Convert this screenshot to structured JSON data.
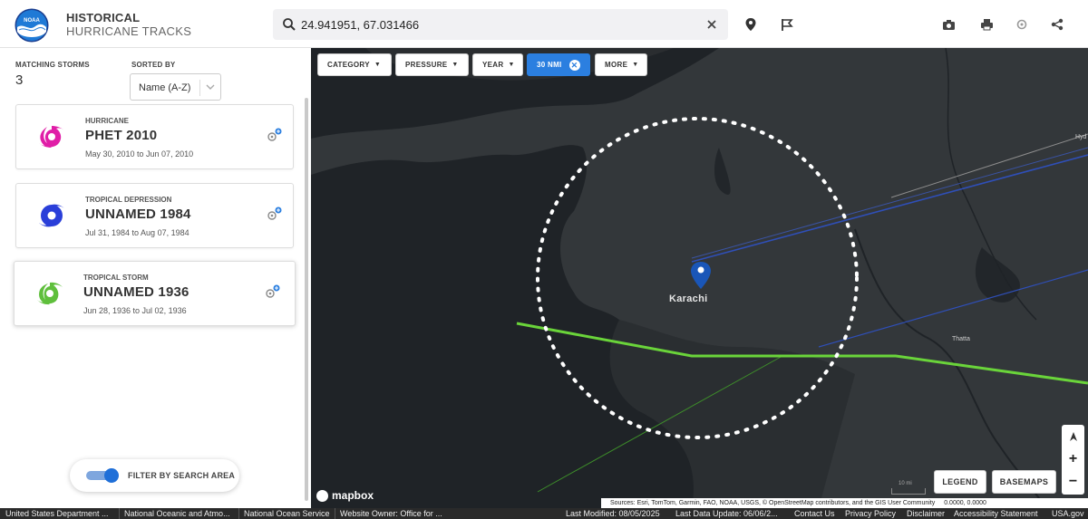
{
  "header": {
    "logo_text": "NOAA",
    "title_line1": "HISTORICAL",
    "title_line2": "HURRICANE TRACKS",
    "search_value": "24.941951, 67.031466"
  },
  "sidebar": {
    "matching_label": "MATCHING STORMS",
    "matching_count": "3",
    "sorted_label": "SORTED BY",
    "sort_value": "Name (A-Z)",
    "filter_toggle_label": "FILTER BY SEARCH AREA",
    "filter_toggle_on": true,
    "storms": [
      {
        "category": "HURRICANE",
        "name": "PHET 2010",
        "dates": "May 30, 2010 to Jun 07, 2010",
        "color": "#e01ea7"
      },
      {
        "category": "TROPICAL DEPRESSION",
        "name": "UNNAMED 1984",
        "dates": "Jul 31, 1984 to Aug 07, 1984",
        "color": "#2a3fd9"
      },
      {
        "category": "TROPICAL STORM",
        "name": "UNNAMED 1936",
        "dates": "Jun 28, 1936 to Jul 02, 1936",
        "color": "#5fbf3c"
      }
    ]
  },
  "map": {
    "filters": {
      "category": "CATEGORY",
      "pressure": "PRESSURE",
      "year": "YEAR",
      "radius": "30 NMI",
      "more": "MORE"
    },
    "city_label": "Karachi",
    "place_thatta": "Thatta",
    "place_hyd": "Hyd",
    "legend_label": "LEGEND",
    "basemaps_label": "BASEMAPS",
    "mapbox_label": "mapbox",
    "scale_label": "10 mi",
    "attribution": "Sources: Esri, TomTom, Garmin, FAO, NOAA, USGS, © OpenStreetMap contributors, and the GIS User Community",
    "coords": "0.0000, 0.0000",
    "zoom_in": "+",
    "zoom_out": "−",
    "colors": {
      "search_circle": "#ffffff",
      "track_green": "#6ad43a",
      "track_blue": "#2f4fb8",
      "active_filter": "#2b7fe0"
    }
  },
  "footer": {
    "link1": "United States Department ...",
    "link2": "National Oceanic and Atmo...",
    "link3": "National Ocean Service",
    "link4": "Website Owner: Office for ...",
    "last_modified": "Last Modified: 08/05/2025",
    "last_update": "Last Data Update: 06/06/2...",
    "contact": "Contact Us",
    "privacy": "Privacy Policy",
    "disclaimer": "Disclaimer",
    "accessibility": "Accessibility Statement",
    "usa": "USA.gov"
  }
}
